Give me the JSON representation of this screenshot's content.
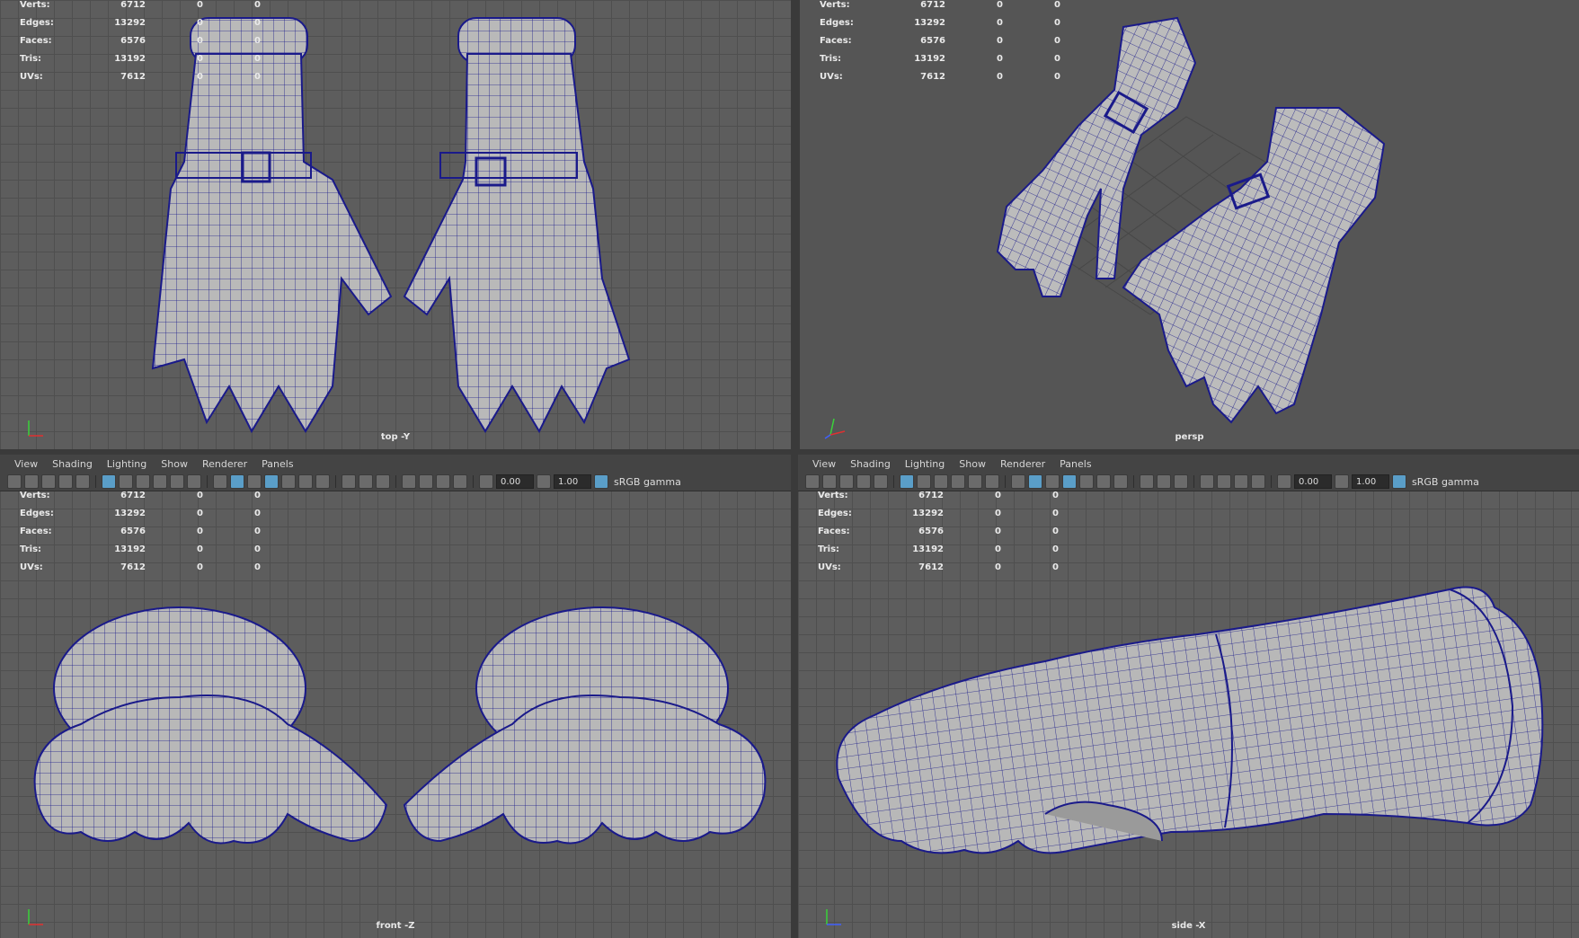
{
  "stats": {
    "labels": [
      "Verts:",
      "Edges:",
      "Faces:",
      "Tris:",
      "UVs:"
    ],
    "values": [
      "6712",
      "13292",
      "6576",
      "13192",
      "7612"
    ],
    "zero": "0"
  },
  "panel_menu": [
    "View",
    "Shading",
    "Lighting",
    "Show",
    "Renderer",
    "Panels"
  ],
  "toolbar": {
    "exposure": "0.00",
    "gamma": "1.00",
    "color_space": "sRGB gamma"
  },
  "viewports": {
    "top": "top -Y",
    "persp": "persp",
    "front": "front -Z",
    "side": "side -X"
  },
  "colors": {
    "wire": "#1a1a8a",
    "mesh": "#b9b9b9",
    "grid": "#4f4f4f",
    "viewport_bg": "#5d5d5d"
  }
}
